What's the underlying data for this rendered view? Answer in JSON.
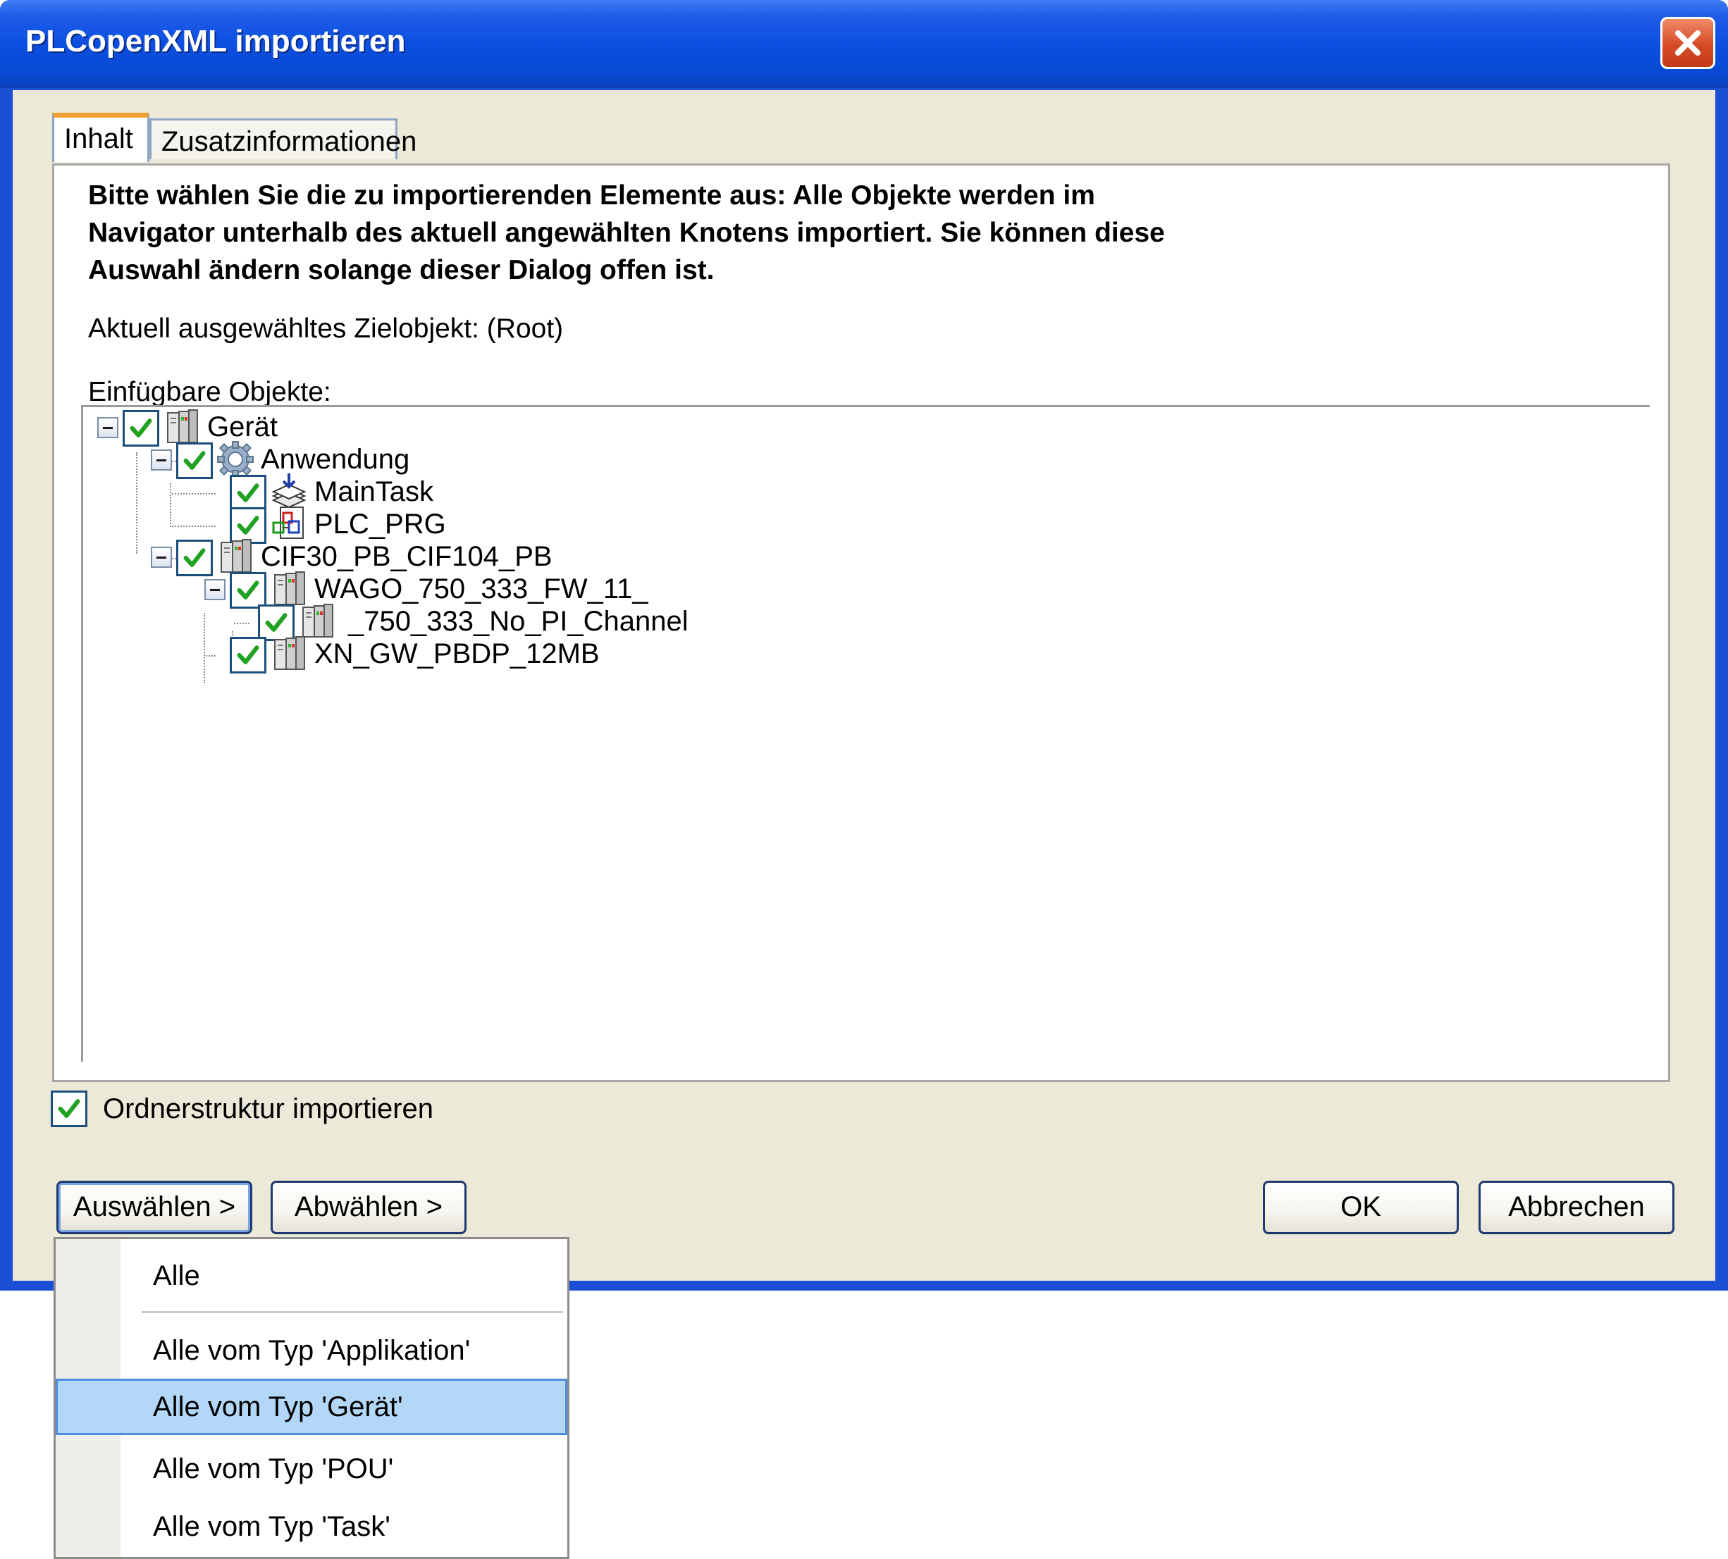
{
  "window": {
    "title": "PLCopenXML importieren"
  },
  "tabs": [
    {
      "label": "Inhalt",
      "active": true
    },
    {
      "label": "Zusatzinformationen",
      "active": false
    }
  ],
  "content": {
    "instruction_lines": [
      "Bitte wählen Sie die zu importierenden Elemente aus: Alle Objekte werden im",
      "Navigator unterhalb des aktuell angewählten Knotens importiert. Sie können diese",
      "Auswahl ändern solange dieser Dialog offen ist."
    ],
    "target_label": "Aktuell ausgewähltes Zielobjekt: (Root)",
    "insertable_label": "Einfügbare Objekte:"
  },
  "tree": [
    {
      "label": "Gerät",
      "icon": "device-icon",
      "checked": true,
      "expanded": true,
      "depth": 0
    },
    {
      "label": "Anwendung",
      "icon": "gear-icon",
      "checked": true,
      "expanded": true,
      "depth": 1
    },
    {
      "label": "MainTask",
      "icon": "task-icon",
      "checked": true,
      "depth": 2
    },
    {
      "label": "PLC_PRG",
      "icon": "pou-icon",
      "checked": true,
      "depth": 2
    },
    {
      "label": "CIF30_PB_CIF104_PB",
      "icon": "device-icon",
      "checked": true,
      "expanded": true,
      "depth": 1
    },
    {
      "label": "WAGO_750_333_FW_11_",
      "icon": "device-icon",
      "checked": true,
      "expanded": true,
      "depth": 2
    },
    {
      "label": "_750_333_No_PI_Channel",
      "icon": "device-icon",
      "checked": true,
      "depth": 3
    },
    {
      "label": "XN_GW_PBDP_12MB",
      "icon": "device-icon",
      "checked": true,
      "depth": 2
    }
  ],
  "options": {
    "import_folder_structure": {
      "label": "Ordnerstruktur importieren",
      "checked": true
    }
  },
  "buttons": {
    "select": "Auswählen >",
    "deselect": "Abwählen >",
    "ok": "OK",
    "cancel": "Abbrechen"
  },
  "menu": {
    "items": [
      {
        "label": "Alle",
        "highlighted": false
      },
      {
        "label": "Alle vom Typ 'Applikation'",
        "highlighted": false
      },
      {
        "label": "Alle vom Typ 'Gerät'",
        "highlighted": true
      },
      {
        "label": "Alle vom Typ 'POU'",
        "highlighted": false
      },
      {
        "label": "Alle vom Typ 'Task'",
        "highlighted": false
      }
    ]
  },
  "colors": {
    "titlebar": "#0c4fe0",
    "dialog_bg": "#ece9d8",
    "checkmark": "#21a121",
    "active_tab_accent": "#f0a030",
    "menu_highlight": "#b3d7f7"
  }
}
